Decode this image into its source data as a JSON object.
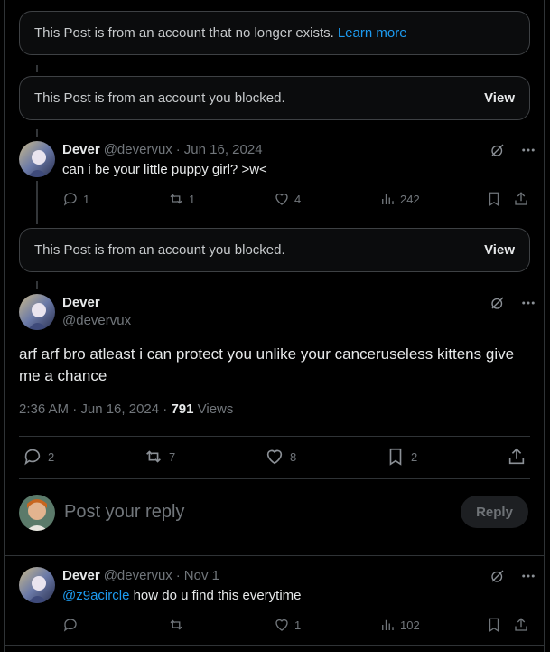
{
  "notices": {
    "deleted_text": "This Post is from an account that no longer exists.",
    "learn_more": "Learn more",
    "blocked_text": "This Post is from an account you blocked.",
    "view_label": "View"
  },
  "post1": {
    "name": "Dever",
    "handle": "@devervux",
    "dot": "·",
    "date": "Jun 16, 2024",
    "text": "can i be your little puppy girl? >w<",
    "replies": "1",
    "reposts": "1",
    "likes": "4",
    "views": "242"
  },
  "main_post": {
    "name": "Dever",
    "handle": "@devervux",
    "text": "arf arf bro atleast i can protect you unlike your canceruseless kittens give me a chance",
    "timestamp": "2:36 AM · Jun 16, 2024 · ",
    "views_count": "791",
    "views_label": "Views",
    "replies": "2",
    "reposts": "7",
    "likes": "8",
    "bookmarks": "2"
  },
  "composer": {
    "placeholder": "Post your reply",
    "reply_button": "Reply"
  },
  "post3": {
    "name": "Dever",
    "handle": "@devervux",
    "dot": "·",
    "date": "Nov 1",
    "mention": "@z9acircle",
    "text": " how do u find this everytime",
    "replies": "",
    "reposts": "",
    "likes": "1",
    "views": "102"
  },
  "colors": {
    "accent": "#1d9bf0",
    "background": "#000000",
    "muted": "#71767b"
  },
  "icons": [
    "reply-icon",
    "repost-icon",
    "like-icon",
    "views-icon",
    "bookmark-icon",
    "share-icon",
    "grok-icon",
    "more-icon"
  ]
}
